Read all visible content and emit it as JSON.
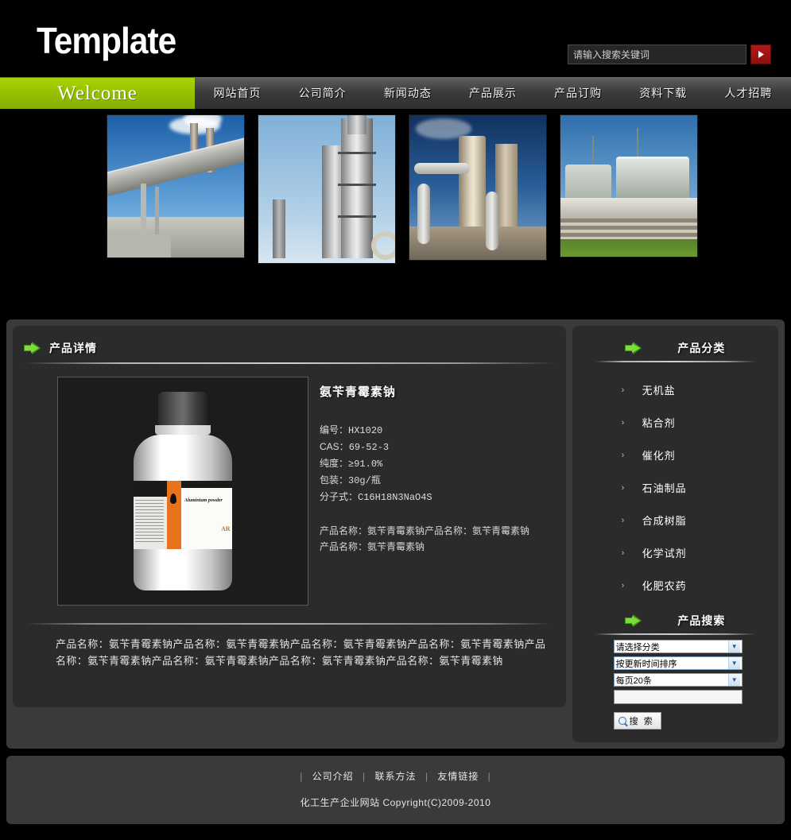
{
  "header": {
    "logo": "Template",
    "search_placeholder": "请输入搜索关键词",
    "search_value": "",
    "search_button_icon": "play-arrow-icon"
  },
  "nav": {
    "welcome": "Welcome",
    "items": [
      {
        "label": "网站首页"
      },
      {
        "label": "公司简介"
      },
      {
        "label": "新闻动态"
      },
      {
        "label": "产品展示"
      },
      {
        "label": "产品订购"
      },
      {
        "label": "资料下载"
      },
      {
        "label": "人才招聘"
      }
    ]
  },
  "banner": {
    "images": [
      {
        "alt": "水泥厂输送带与烟囱"
      },
      {
        "alt": "炼油厂蒸馏塔"
      },
      {
        "alt": "化工装置管道"
      },
      {
        "alt": "储油罐区"
      }
    ]
  },
  "main": {
    "title": "产品详情",
    "product": {
      "name": "氨苄青霉素钠",
      "image_alt": "Aluminium powder 化学试剂瓶",
      "image_label_text": "Aluminium powder",
      "image_label_grade": "AR",
      "specs": [
        {
          "label": "编号：",
          "value": "HX1020"
        },
        {
          "label": "CAS：",
          "value": "69-52-3"
        },
        {
          "label": "纯度：",
          "value": "≥91.0%"
        },
        {
          "label": "包装：",
          "value": "30g/瓶"
        },
        {
          "label": "分子式：",
          "value": "C16H18N3NaO4S"
        }
      ],
      "extra_lines": [
        "产品名称：氨苄青霉素钠产品名称：氨苄青霉素钠",
        "产品名称：氨苄青霉素钠"
      ],
      "description": "产品名称：氨苄青霉素钠产品名称：氨苄青霉素钠产品名称：氨苄青霉素钠产品名称：氨苄青霉素钠产品名称：氨苄青霉素钠产品名称：氨苄青霉素钠产品名称：氨苄青霉素钠产品名称：氨苄青霉素钠"
    }
  },
  "sidebar": {
    "category_title": "产品分类",
    "categories": [
      {
        "label": "无机盐"
      },
      {
        "label": "粘合剂"
      },
      {
        "label": "催化剂"
      },
      {
        "label": "石油制品"
      },
      {
        "label": "合成树脂"
      },
      {
        "label": "化学试剂"
      },
      {
        "label": "化肥农药"
      }
    ],
    "search_title": "产品搜索",
    "search": {
      "category_select": "请选择分类",
      "sort_select": "按更新时间排序",
      "perpage_select": "每页20条",
      "keyword_value": "",
      "button_label": "搜 索"
    }
  },
  "footer": {
    "links": [
      {
        "label": "公司介绍"
      },
      {
        "label": "联系方法"
      },
      {
        "label": "友情链接"
      }
    ],
    "divider": "|",
    "copyright": "化工生产企业网站 Copyright(C)2009-2010"
  },
  "colors": {
    "accent_green": "#a8d400",
    "page_bg": "#000000",
    "panel_bg": "#2b2b2b",
    "outer_bg": "#3a3a3a",
    "search_btn_red": "#b51919"
  }
}
